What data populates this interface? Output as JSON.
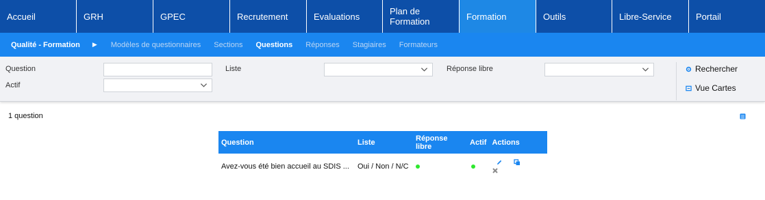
{
  "topnav": {
    "items": [
      {
        "label": "Accueil",
        "active": false
      },
      {
        "label": "GRH",
        "active": false
      },
      {
        "label": "GPEC",
        "active": false
      },
      {
        "label": "Recrutement",
        "active": false
      },
      {
        "label": "Evaluations",
        "active": false
      },
      {
        "label": "Plan de Formation",
        "active": false
      },
      {
        "label": "Formation",
        "active": true
      },
      {
        "label": "Outils",
        "active": false
      },
      {
        "label": "Libre-Service",
        "active": false
      },
      {
        "label": "Portail",
        "active": false
      }
    ]
  },
  "subnav": {
    "root": "Qualité - Formation",
    "items": [
      {
        "label": "Modèles de questionnaires",
        "active": false
      },
      {
        "label": "Sections",
        "active": false
      },
      {
        "label": "Questions",
        "active": true
      },
      {
        "label": "Réponses",
        "active": false
      },
      {
        "label": "Stagiaires",
        "active": false
      },
      {
        "label": "Formateurs",
        "active": false
      }
    ]
  },
  "filters": {
    "question_label": "Question",
    "question_value": "",
    "actif_label": "Actif",
    "actif_value": "",
    "liste_label": "Liste",
    "liste_value": "",
    "reponse_libre_label": "Réponse libre",
    "reponse_libre_value": "",
    "search_label": "Rechercher",
    "cards_label": "Vue Cartes"
  },
  "results": {
    "count_text": "1 question",
    "columns": [
      "Question",
      "Liste",
      "Réponse libre",
      "Actif",
      "Actions"
    ],
    "rows": [
      {
        "question": "Avez-vous été bien accueil au SDIS ...",
        "liste": "Oui / Non / N/C",
        "reponse_libre": true,
        "actif": true
      }
    ]
  },
  "colors": {
    "nav_dark": "#0d4fa8",
    "nav_active": "#1e88e5",
    "subnav": "#1a86f0",
    "status_dot": "#2ee82e",
    "icon_blue": "#1a86f0",
    "icon_gray": "#8a8a8a"
  },
  "icons": {
    "search": "search-icon",
    "cards": "cards-icon",
    "view_toggle": "list-view-icon",
    "edit": "pencil-icon",
    "copy": "copy-icon",
    "delete": "close-icon"
  }
}
